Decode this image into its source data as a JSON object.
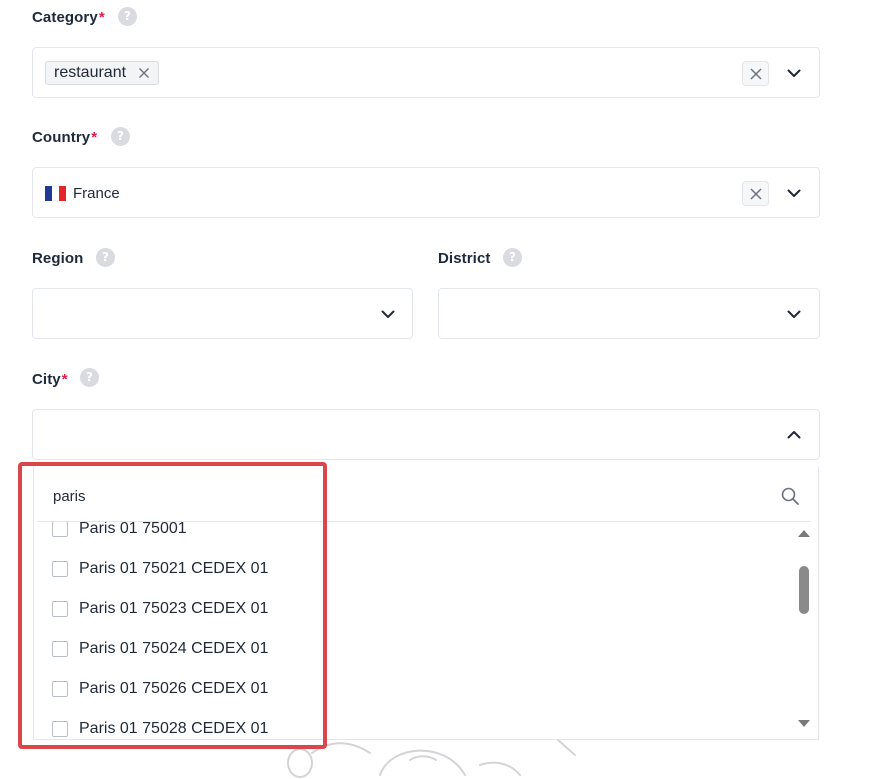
{
  "category": {
    "label": "Category",
    "required_mark": "*",
    "help_glyph": "?",
    "selected_chips": [
      {
        "label": "restaurant"
      }
    ]
  },
  "country": {
    "label": "Country",
    "required_mark": "*",
    "help_glyph": "?",
    "value": "France",
    "flag_colors": [
      "#1f3a93",
      "#ffffff",
      "#e4262b"
    ]
  },
  "region": {
    "label": "Region",
    "help_glyph": "?",
    "value": ""
  },
  "district": {
    "label": "District",
    "help_glyph": "?",
    "value": ""
  },
  "city": {
    "label": "City",
    "required_mark": "*",
    "help_glyph": "?",
    "value": "",
    "dropdown": {
      "search_value": "paris",
      "options": [
        {
          "label": "Paris 01 75001",
          "checked": false
        },
        {
          "label": "Paris 01 75021 CEDEX 01",
          "checked": false
        },
        {
          "label": "Paris 01 75023 CEDEX 01",
          "checked": false
        },
        {
          "label": "Paris 01 75024 CEDEX 01",
          "checked": false
        },
        {
          "label": "Paris 01 75026 CEDEX 01",
          "checked": false
        },
        {
          "label": "Paris 01 75028 CEDEX 01",
          "checked": false
        }
      ]
    }
  },
  "icons": {
    "help": "question-mark-icon",
    "remove_chip": "close-icon",
    "clear": "close-icon",
    "expand": "chevron-down-icon",
    "collapse": "chevron-up-icon",
    "search": "search-icon",
    "scroll_up": "triangle-up-icon",
    "scroll_down": "triangle-down-icon"
  },
  "colors": {
    "required": "#e11d48",
    "highlight_box": "#d9474b",
    "field_border": "#e3e6ea",
    "help_badge": "#d9dbe0"
  }
}
